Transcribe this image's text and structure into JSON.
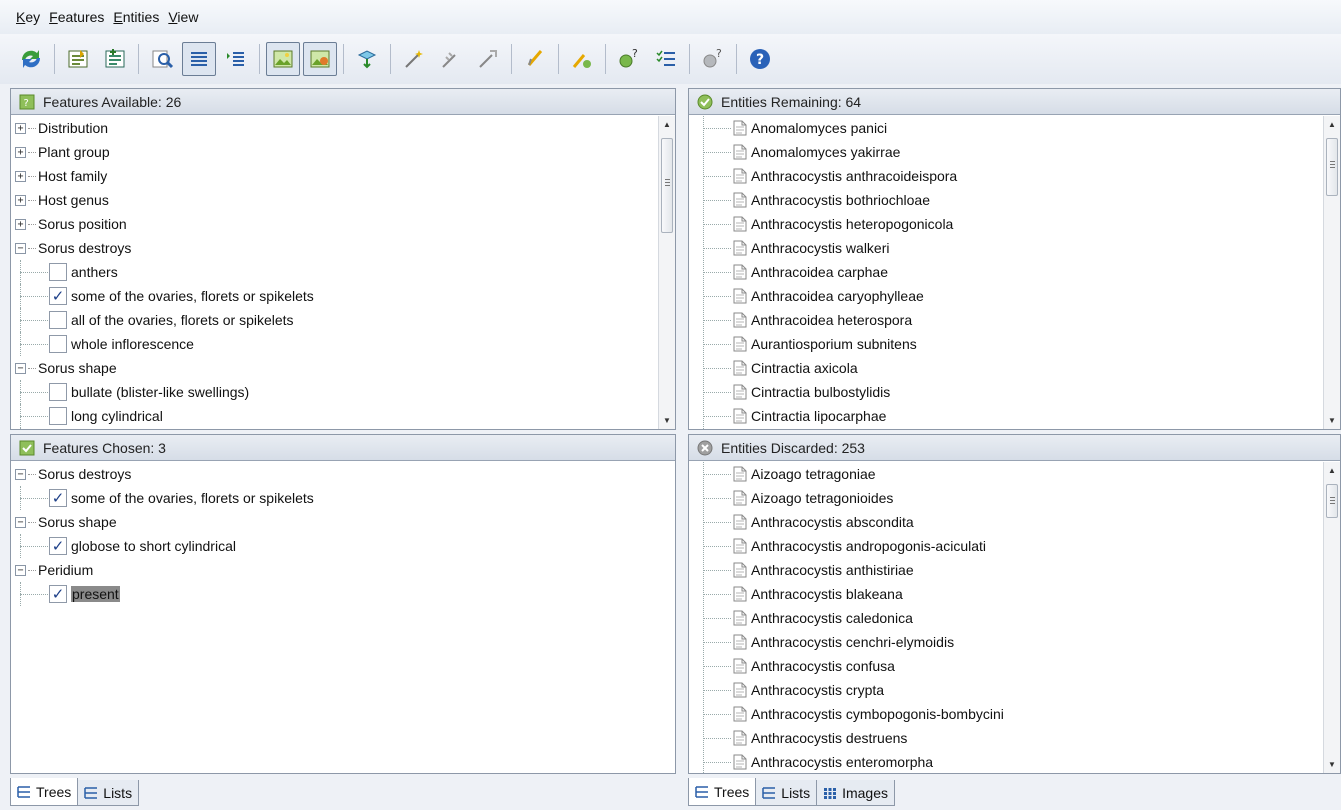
{
  "menu": [
    "Key",
    "Features",
    "Entities",
    "View"
  ],
  "colors": {
    "accent": "#1d3f88",
    "header_green": "#79b84b",
    "discard_gray": "#9a9a9a"
  },
  "features_available": {
    "header": "Features Available: 26",
    "rows": [
      {
        "kind": "group",
        "expander": "+",
        "label": "Distribution"
      },
      {
        "kind": "group",
        "expander": "+",
        "label": "Plant group"
      },
      {
        "kind": "group",
        "expander": "+",
        "label": "Host family"
      },
      {
        "kind": "group",
        "expander": "+",
        "label": "Host genus"
      },
      {
        "kind": "group",
        "expander": "+",
        "label": "Sorus position"
      },
      {
        "kind": "group",
        "expander": "-",
        "label": "Sorus destroys"
      },
      {
        "kind": "child",
        "checked": false,
        "label": "anthers"
      },
      {
        "kind": "child",
        "checked": true,
        "label": "some of the ovaries, florets or spikelets"
      },
      {
        "kind": "child",
        "checked": false,
        "label": "all of the ovaries, florets or spikelets"
      },
      {
        "kind": "child",
        "checked": false,
        "label": "whole inflorescence"
      },
      {
        "kind": "group",
        "expander": "-",
        "label": "Sorus shape"
      },
      {
        "kind": "child",
        "checked": false,
        "label": "bullate (blister-like swellings)"
      },
      {
        "kind": "child",
        "checked": false,
        "label": "long cylindrical"
      },
      {
        "kind": "child",
        "checked": true,
        "label": "globose to short cylindrical"
      }
    ]
  },
  "features_chosen": {
    "header": "Features Chosen: 3",
    "rows": [
      {
        "kind": "group",
        "expander": "-",
        "label": "Sorus destroys"
      },
      {
        "kind": "child",
        "checked": true,
        "label": "some of the ovaries, florets or spikelets"
      },
      {
        "kind": "group",
        "expander": "-",
        "label": "Sorus shape"
      },
      {
        "kind": "child",
        "checked": true,
        "label": "globose to short cylindrical"
      },
      {
        "kind": "group",
        "expander": "-",
        "label": "Peridium"
      },
      {
        "kind": "child",
        "checked": true,
        "label": "present",
        "selected": true
      }
    ]
  },
  "entities_remaining": {
    "header": "Entities Remaining: 64",
    "items": [
      "Anomalomyces panici",
      "Anomalomyces yakirrae",
      "Anthracocystis anthracoideispora",
      "Anthracocystis bothriochloae",
      "Anthracocystis heteropogonicola",
      "Anthracocystis walkeri",
      "Anthracoidea carphae",
      "Anthracoidea caryophylleae",
      "Anthracoidea heterospora",
      "Aurantiosporium subnitens",
      "Cintractia axicola",
      "Cintractia bulbostylidis",
      "Cintractia lipocarphae"
    ]
  },
  "entities_discarded": {
    "header": "Entities Discarded: 253",
    "items": [
      "Aizoago tetragoniae",
      "Aizoago tetragonioides",
      "Anthracocystis abscondita",
      "Anthracocystis andropogonis-aciculati",
      "Anthracocystis anthistiriae",
      "Anthracocystis blakeana",
      "Anthracocystis caledonica",
      "Anthracocystis cenchri-elymoidis",
      "Anthracocystis confusa",
      "Anthracocystis crypta",
      "Anthracocystis cymbopogonis-bombycini",
      "Anthracocystis destruens",
      "Anthracocystis enteromorpha"
    ]
  },
  "left_tabs": [
    {
      "label": "Trees",
      "icon": "tree-icon",
      "active": true
    },
    {
      "label": "Lists",
      "icon": "list-icon",
      "active": false
    }
  ],
  "right_tabs": [
    {
      "label": "Trees",
      "icon": "tree-icon",
      "active": true
    },
    {
      "label": "Lists",
      "icon": "list-icon",
      "active": false
    },
    {
      "label": "Images",
      "icon": "images-icon",
      "active": false
    }
  ]
}
